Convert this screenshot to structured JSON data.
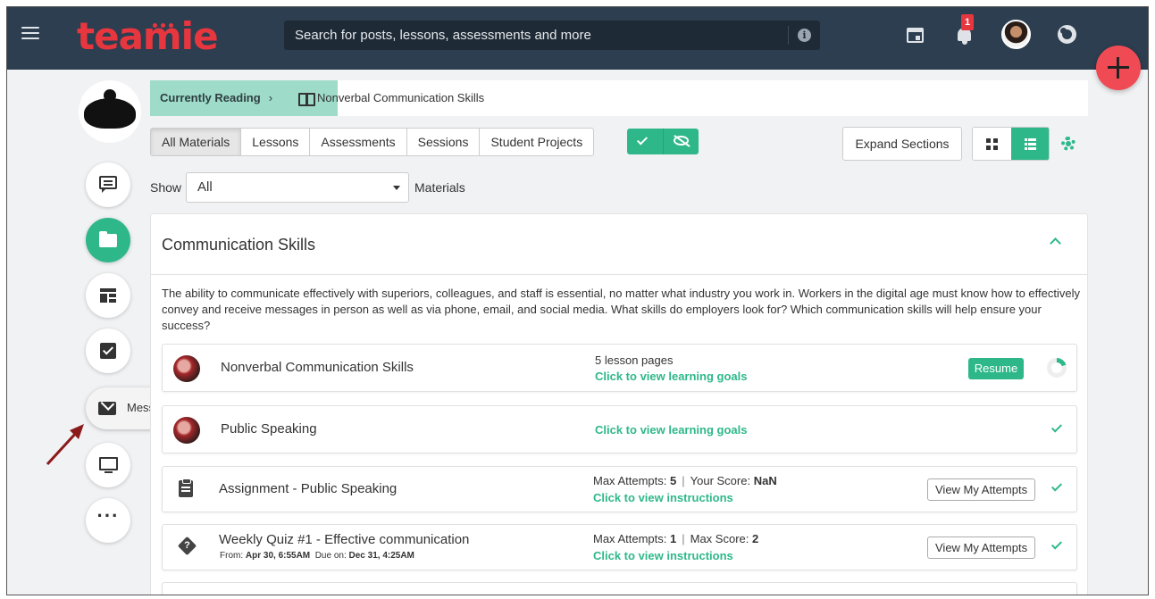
{
  "header": {
    "logo_text": "teamie",
    "search_placeholder": "Search for posts, lessons, assessments and more",
    "notification_count": "1",
    "icons": [
      "hamburger-menu-icon",
      "info-icon",
      "calendar-icon",
      "bell-icon",
      "avatar",
      "help-lifebuoy-icon",
      "add-icon"
    ],
    "colors": {
      "header_bg": "#2c3e4f",
      "brand": "#e8363f",
      "accent": "#2eb88a"
    }
  },
  "rail": {
    "messages_label": "Messages"
  },
  "breadcrumb": {
    "label": "Currently Reading",
    "chevron": "›",
    "title": "Nonverbal Communication Skills"
  },
  "tabs": [
    {
      "label": "All Materials",
      "active": true
    },
    {
      "label": "Lessons"
    },
    {
      "label": "Assessments"
    },
    {
      "label": "Sessions"
    },
    {
      "label": "Student Projects"
    }
  ],
  "toolbar": {
    "expand_label": "Expand Sections"
  },
  "filter": {
    "show_label": "Show",
    "selected": "All",
    "materials_label": "Materials"
  },
  "section": {
    "title": "Communication Skills",
    "description": "The ability to communicate effectively with superiors, colleagues, and staff is essential, no matter what industry you work in. Workers in the digital age must know how to effectively convey and receive messages in person as well as via phone, email, and social media. What skills do employers look for? Which communication skills will help ensure your success?",
    "items": [
      {
        "title": "Nonverbal Communication Skills",
        "meta": "5 lesson pages",
        "link": "Click to view learning goals",
        "action": "Resume",
        "progress": 0.2
      },
      {
        "title": "Public Speaking",
        "link": "Click to view learning goals",
        "status": "complete"
      },
      {
        "title": "Assignment - Public Speaking",
        "meta_label1": "Max Attempts:",
        "meta_value1": "5",
        "meta_sep": "|",
        "meta_label2": "Your Score:",
        "meta_value2": "NaN",
        "link": "Click to view instructions",
        "action": "View My Attempts",
        "status": "complete"
      },
      {
        "title": "Weekly Quiz #1 - Effective communication",
        "sub_from_label": "From:",
        "sub_from": "Apr 30, 6:55AM",
        "sub_due_label": "Due on:",
        "sub_due": "Dec 31, 4:25AM",
        "meta_label1": "Max Attempts:",
        "meta_value1": "1",
        "meta_sep": "|",
        "meta_label2": "Max Score:",
        "meta_value2": "2",
        "link": "Click to view instructions",
        "action": "View My Attempts",
        "status": "complete"
      }
    ]
  }
}
